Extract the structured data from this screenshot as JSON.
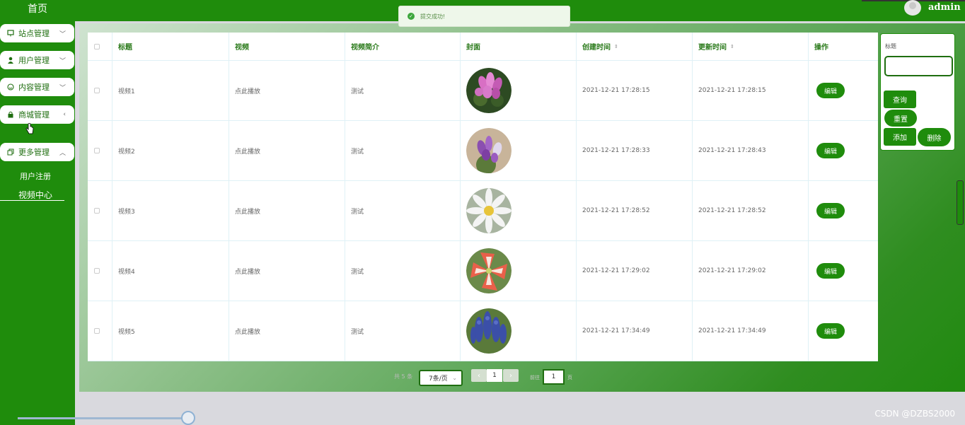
{
  "sidebar": {
    "home": "首页",
    "menus": [
      {
        "label": "站点管理",
        "icon": "monitor-icon",
        "chevron": "﹀"
      },
      {
        "label": "用户管理",
        "icon": "user-icon",
        "chevron": "﹀"
      },
      {
        "label": "内容管理",
        "icon": "smile-icon",
        "chevron": "﹀"
      },
      {
        "label": "商城管理",
        "icon": "bag-icon",
        "chevron": "‹"
      },
      {
        "label": "更多管理",
        "icon": "copy-icon",
        "chevron": "︿"
      }
    ],
    "subitems": [
      "用户注册",
      "视频中心"
    ]
  },
  "header": {
    "user": "admin"
  },
  "toast": {
    "message": "提交成功!"
  },
  "table": {
    "headers": [
      "标题",
      "视频",
      "视频简介",
      "封面",
      "创建时间",
      "更新时间",
      "操作"
    ],
    "sort_icon": "⇕",
    "edit_label": "编辑",
    "rows": [
      {
        "title": "视频1",
        "video": "点此播放",
        "intro": "测试",
        "cover": "pink-cyclamen",
        "created": "2021-12-21 17:28:15",
        "updated": "2021-12-21 17:28:15"
      },
      {
        "title": "视频2",
        "video": "点此播放",
        "intro": "测试",
        "cover": "purple-cyclamen",
        "created": "2021-12-21 17:28:33",
        "updated": "2021-12-21 17:28:43"
      },
      {
        "title": "视频3",
        "video": "点此播放",
        "intro": "测试",
        "cover": "white-daisy",
        "created": "2021-12-21 17:28:52",
        "updated": "2021-12-21 17:28:52"
      },
      {
        "title": "视频4",
        "video": "点此播放",
        "intro": "测试",
        "cover": "red-amaryllis",
        "created": "2021-12-21 17:29:02",
        "updated": "2021-12-21 17:29:02"
      },
      {
        "title": "视频5",
        "video": "点此播放",
        "intro": "测试",
        "cover": "blue-hyacinth",
        "created": "2021-12-21 17:34:49",
        "updated": "2021-12-21 17:34:49"
      }
    ]
  },
  "pagination": {
    "total": "共 5 条",
    "page_size": "7条/页",
    "prev": "‹",
    "next": "›",
    "current_page": "1",
    "goto_prefix": "前往",
    "goto_value": "1",
    "goto_suffix": "页"
  },
  "search_panel": {
    "label": "标题",
    "input_value": "",
    "query": "查询",
    "reset": "重置",
    "add": "添加",
    "delete": "删除"
  },
  "colors": {
    "primary": "#1f8c0c",
    "sidebar": "#1f8c0c"
  },
  "watermark": "CSDN @DZBS2000"
}
